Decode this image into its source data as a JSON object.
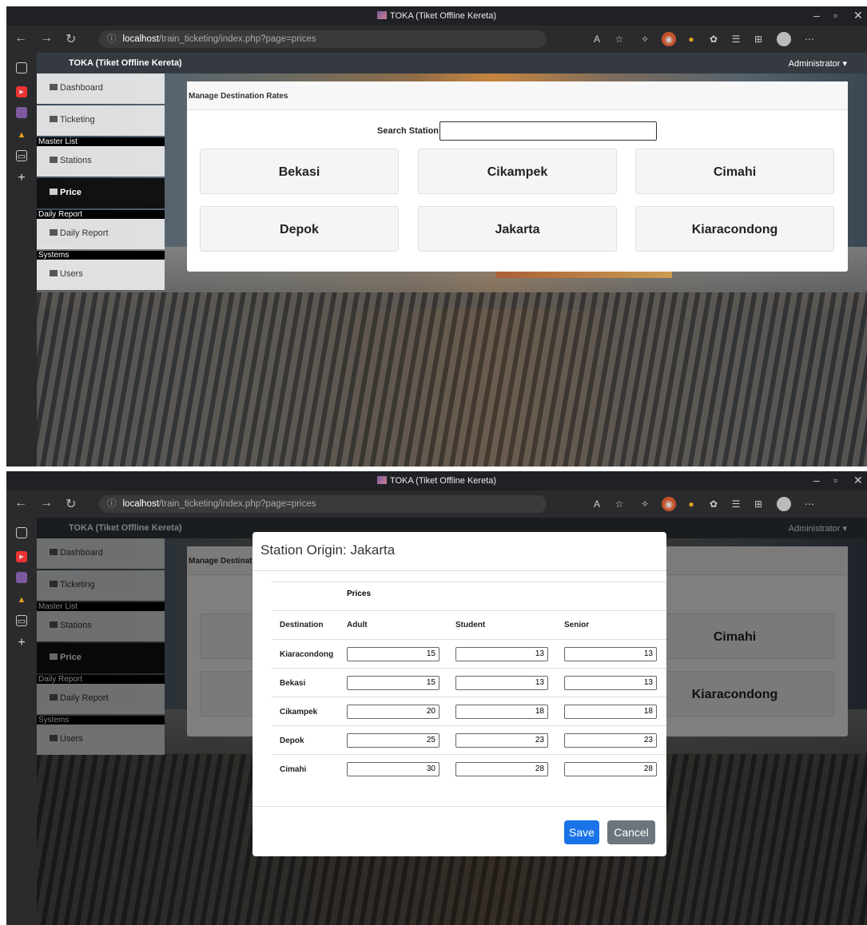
{
  "browser": {
    "window_title": "TOKA (Tiket Offline Kereta)",
    "url_prefix": "ⓘ",
    "url_host": "localhost",
    "url_path": "/train_ticketing/index.php?page=prices"
  },
  "navbar": {
    "brand": "TOKA (Tiket Offline Kereta)",
    "user_menu": "Administrator ▾"
  },
  "sidebar": {
    "dashboard": "Dashboard",
    "ticketing": "Ticketing",
    "section_master": "Master List",
    "stations": "Stations",
    "price": "Price",
    "section_daily": "Daily Report",
    "daily_report": "Daily Report",
    "section_systems": "Systems",
    "users": "Users"
  },
  "main": {
    "card_title": "Manage Destination Rates",
    "search_label": "Search Station",
    "search_value": "",
    "stations": [
      "Bekasi",
      "Cikampek",
      "Cimahi",
      "Depok",
      "Jakarta",
      "Kiaracondong"
    ]
  },
  "modal": {
    "title": "Station Origin: Jakarta",
    "prices_header": "Prices",
    "col_destination": "Destination",
    "col_adult": "Adult",
    "col_student": "Student",
    "col_senior": "Senior",
    "rows": [
      {
        "destination": "Kiaracondong",
        "adult": "15",
        "student": "13",
        "senior": "13"
      },
      {
        "destination": "Bekasi",
        "adult": "15",
        "student": "13",
        "senior": "13"
      },
      {
        "destination": "Cikampek",
        "adult": "20",
        "student": "18",
        "senior": "18"
      },
      {
        "destination": "Depok",
        "adult": "25",
        "student": "23",
        "senior": "23"
      },
      {
        "destination": "Cimahi",
        "adult": "30",
        "student": "28",
        "senior": "28"
      }
    ],
    "save_label": "Save",
    "cancel_label": "Cancel"
  },
  "colors": {
    "navbar": "#343a40",
    "save_button": "#1a73e8",
    "cancel_button": "#6c757d"
  }
}
